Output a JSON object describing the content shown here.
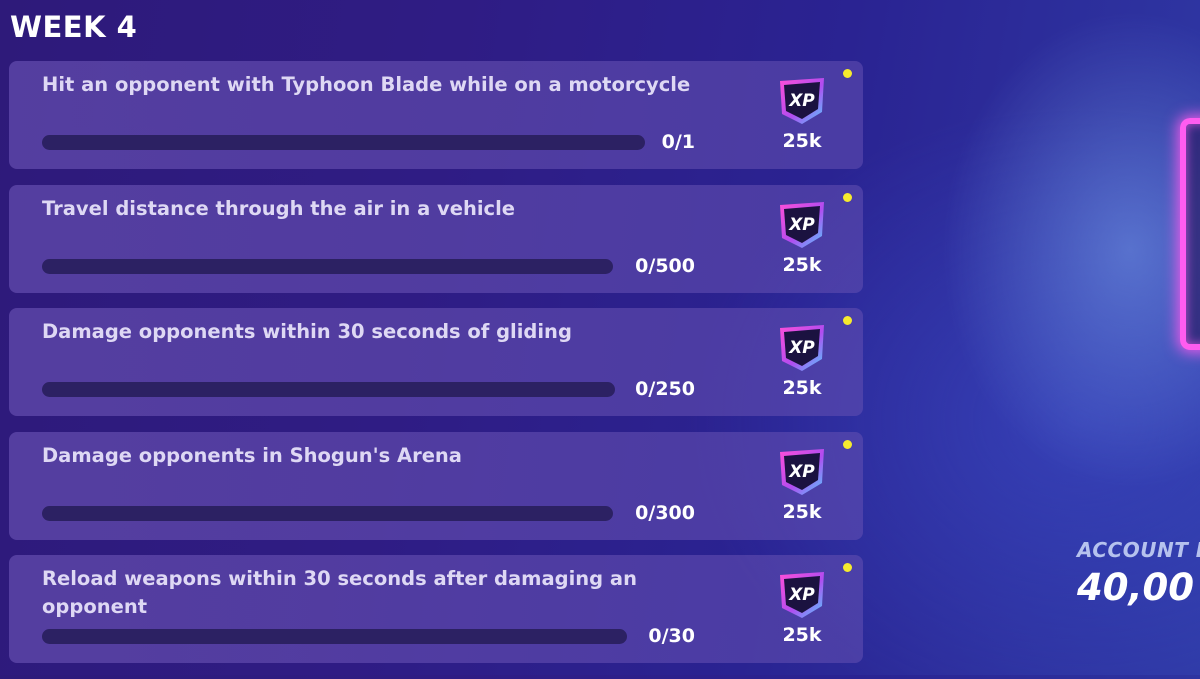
{
  "week": {
    "title": "WEEK 4"
  },
  "quests": [
    {
      "description": "Hit an opponent with Typhoon Blade while on a motorcycle",
      "progress_text": "0/1",
      "progress": 0,
      "reward_icon": "xp-badge-icon",
      "reward_label": "XP",
      "reward_amount": "25k",
      "new_indicator_color": "#f6ea2e"
    },
    {
      "description": "Travel distance through the air in a vehicle",
      "progress_text": "0/500",
      "progress": 0,
      "reward_icon": "xp-badge-icon",
      "reward_label": "XP",
      "reward_amount": "25k",
      "new_indicator_color": "#f6ea2e"
    },
    {
      "description": "Damage opponents within 30 seconds of gliding",
      "progress_text": "0/250",
      "progress": 0,
      "reward_icon": "xp-badge-icon",
      "reward_label": "XP",
      "reward_amount": "25k",
      "new_indicator_color": "#f6ea2e"
    },
    {
      "description": "Damage opponents in Shogun's Arena",
      "progress_text": "0/300",
      "progress": 0,
      "reward_icon": "xp-badge-icon",
      "reward_label": "XP",
      "reward_amount": "25k",
      "new_indicator_color": "#f6ea2e"
    },
    {
      "description": "Reload weapons within 30 seconds after damaging an opponent",
      "progress_text": "0/30",
      "progress": 0,
      "reward_icon": "xp-badge-icon",
      "reward_label": "XP",
      "reward_amount": "25k",
      "new_indicator_color": "#f6ea2e"
    }
  ],
  "account": {
    "label": "ACCOUNT L",
    "value": "40,00"
  },
  "colors": {
    "accent_glow": "#ff5cf0",
    "progress_fill": "#f4e23e",
    "progress_track": "#2c2163",
    "card_text": "#ded8f4"
  }
}
